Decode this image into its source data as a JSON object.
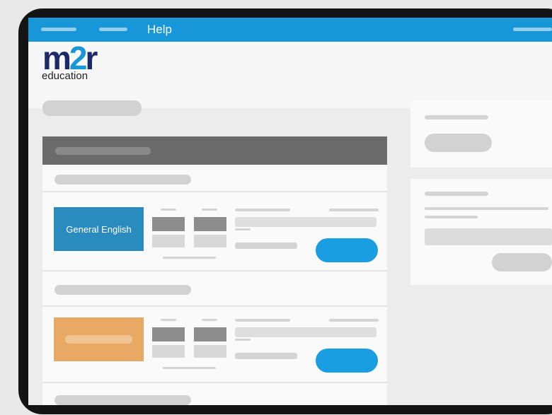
{
  "topbar": {
    "help_label": "Help",
    "bg": "#1796d8"
  },
  "logo": {
    "mark_m": "m",
    "mark_2": "2",
    "mark_r": "r",
    "subtitle": "education"
  },
  "courses": [
    {
      "name": "General English",
      "thumb_color": "#2a8bbf"
    },
    {
      "name": "",
      "thumb_color": "#e8a964"
    }
  ],
  "accent": "#1a9ee2"
}
